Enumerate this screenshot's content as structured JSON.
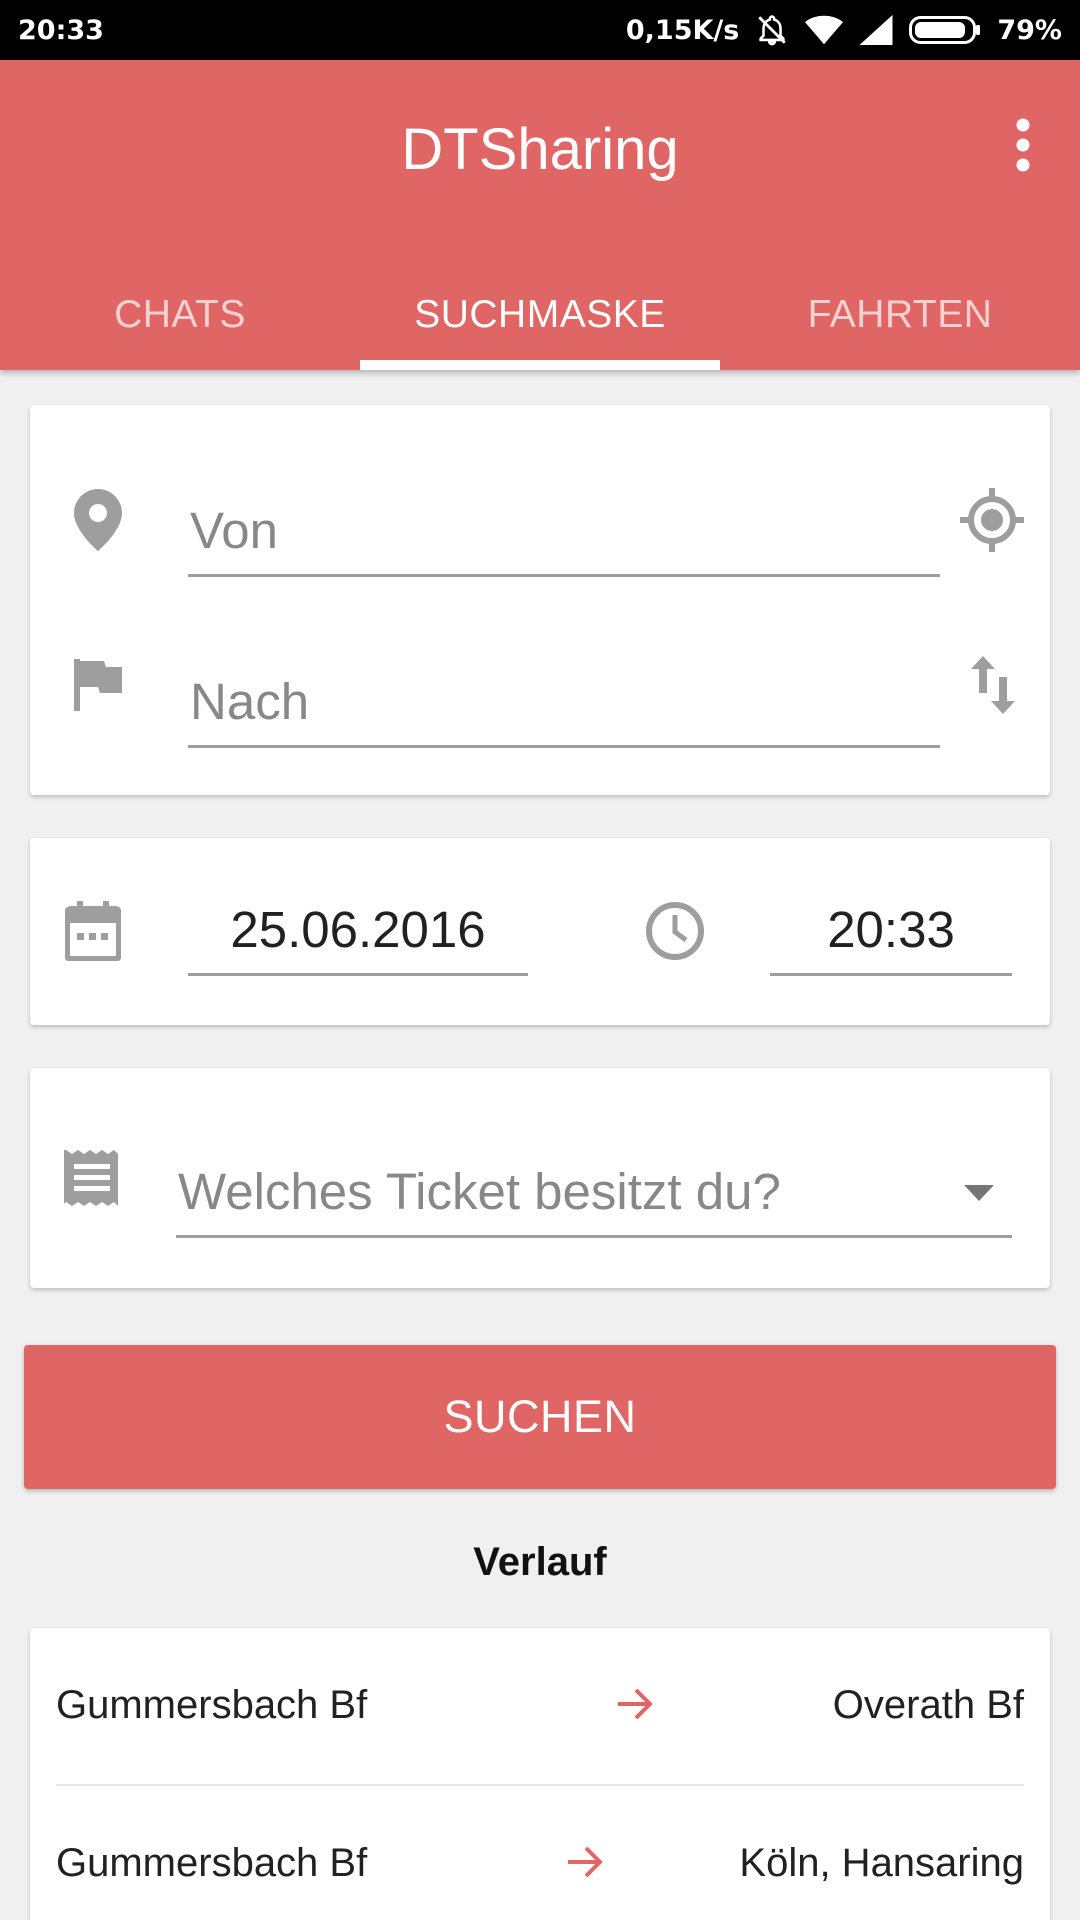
{
  "status_bar": {
    "time": "20:33",
    "network_speed": "0,15K/s",
    "battery": "79%"
  },
  "app_bar": {
    "title": "DTSharing"
  },
  "tabs": [
    {
      "label": "CHATS",
      "active": false
    },
    {
      "label": "SUCHMASKE",
      "active": true
    },
    {
      "label": "FAHRTEN",
      "active": false
    }
  ],
  "route": {
    "from_placeholder": "Von",
    "to_placeholder": "Nach"
  },
  "datetime": {
    "date": "25.06.2016",
    "time": "20:33"
  },
  "ticket": {
    "placeholder": "Welches Ticket besitzt du?"
  },
  "search_button": "SUCHEN",
  "history": {
    "title": "Verlauf",
    "items": [
      {
        "from": "Gummersbach Bf",
        "to": "Overath Bf"
      },
      {
        "from": "Gummersbach Bf",
        "to": "Köln, Hansaring"
      }
    ]
  },
  "colors": {
    "primary": "#e06666",
    "icon_gray": "#9e9e9e"
  }
}
